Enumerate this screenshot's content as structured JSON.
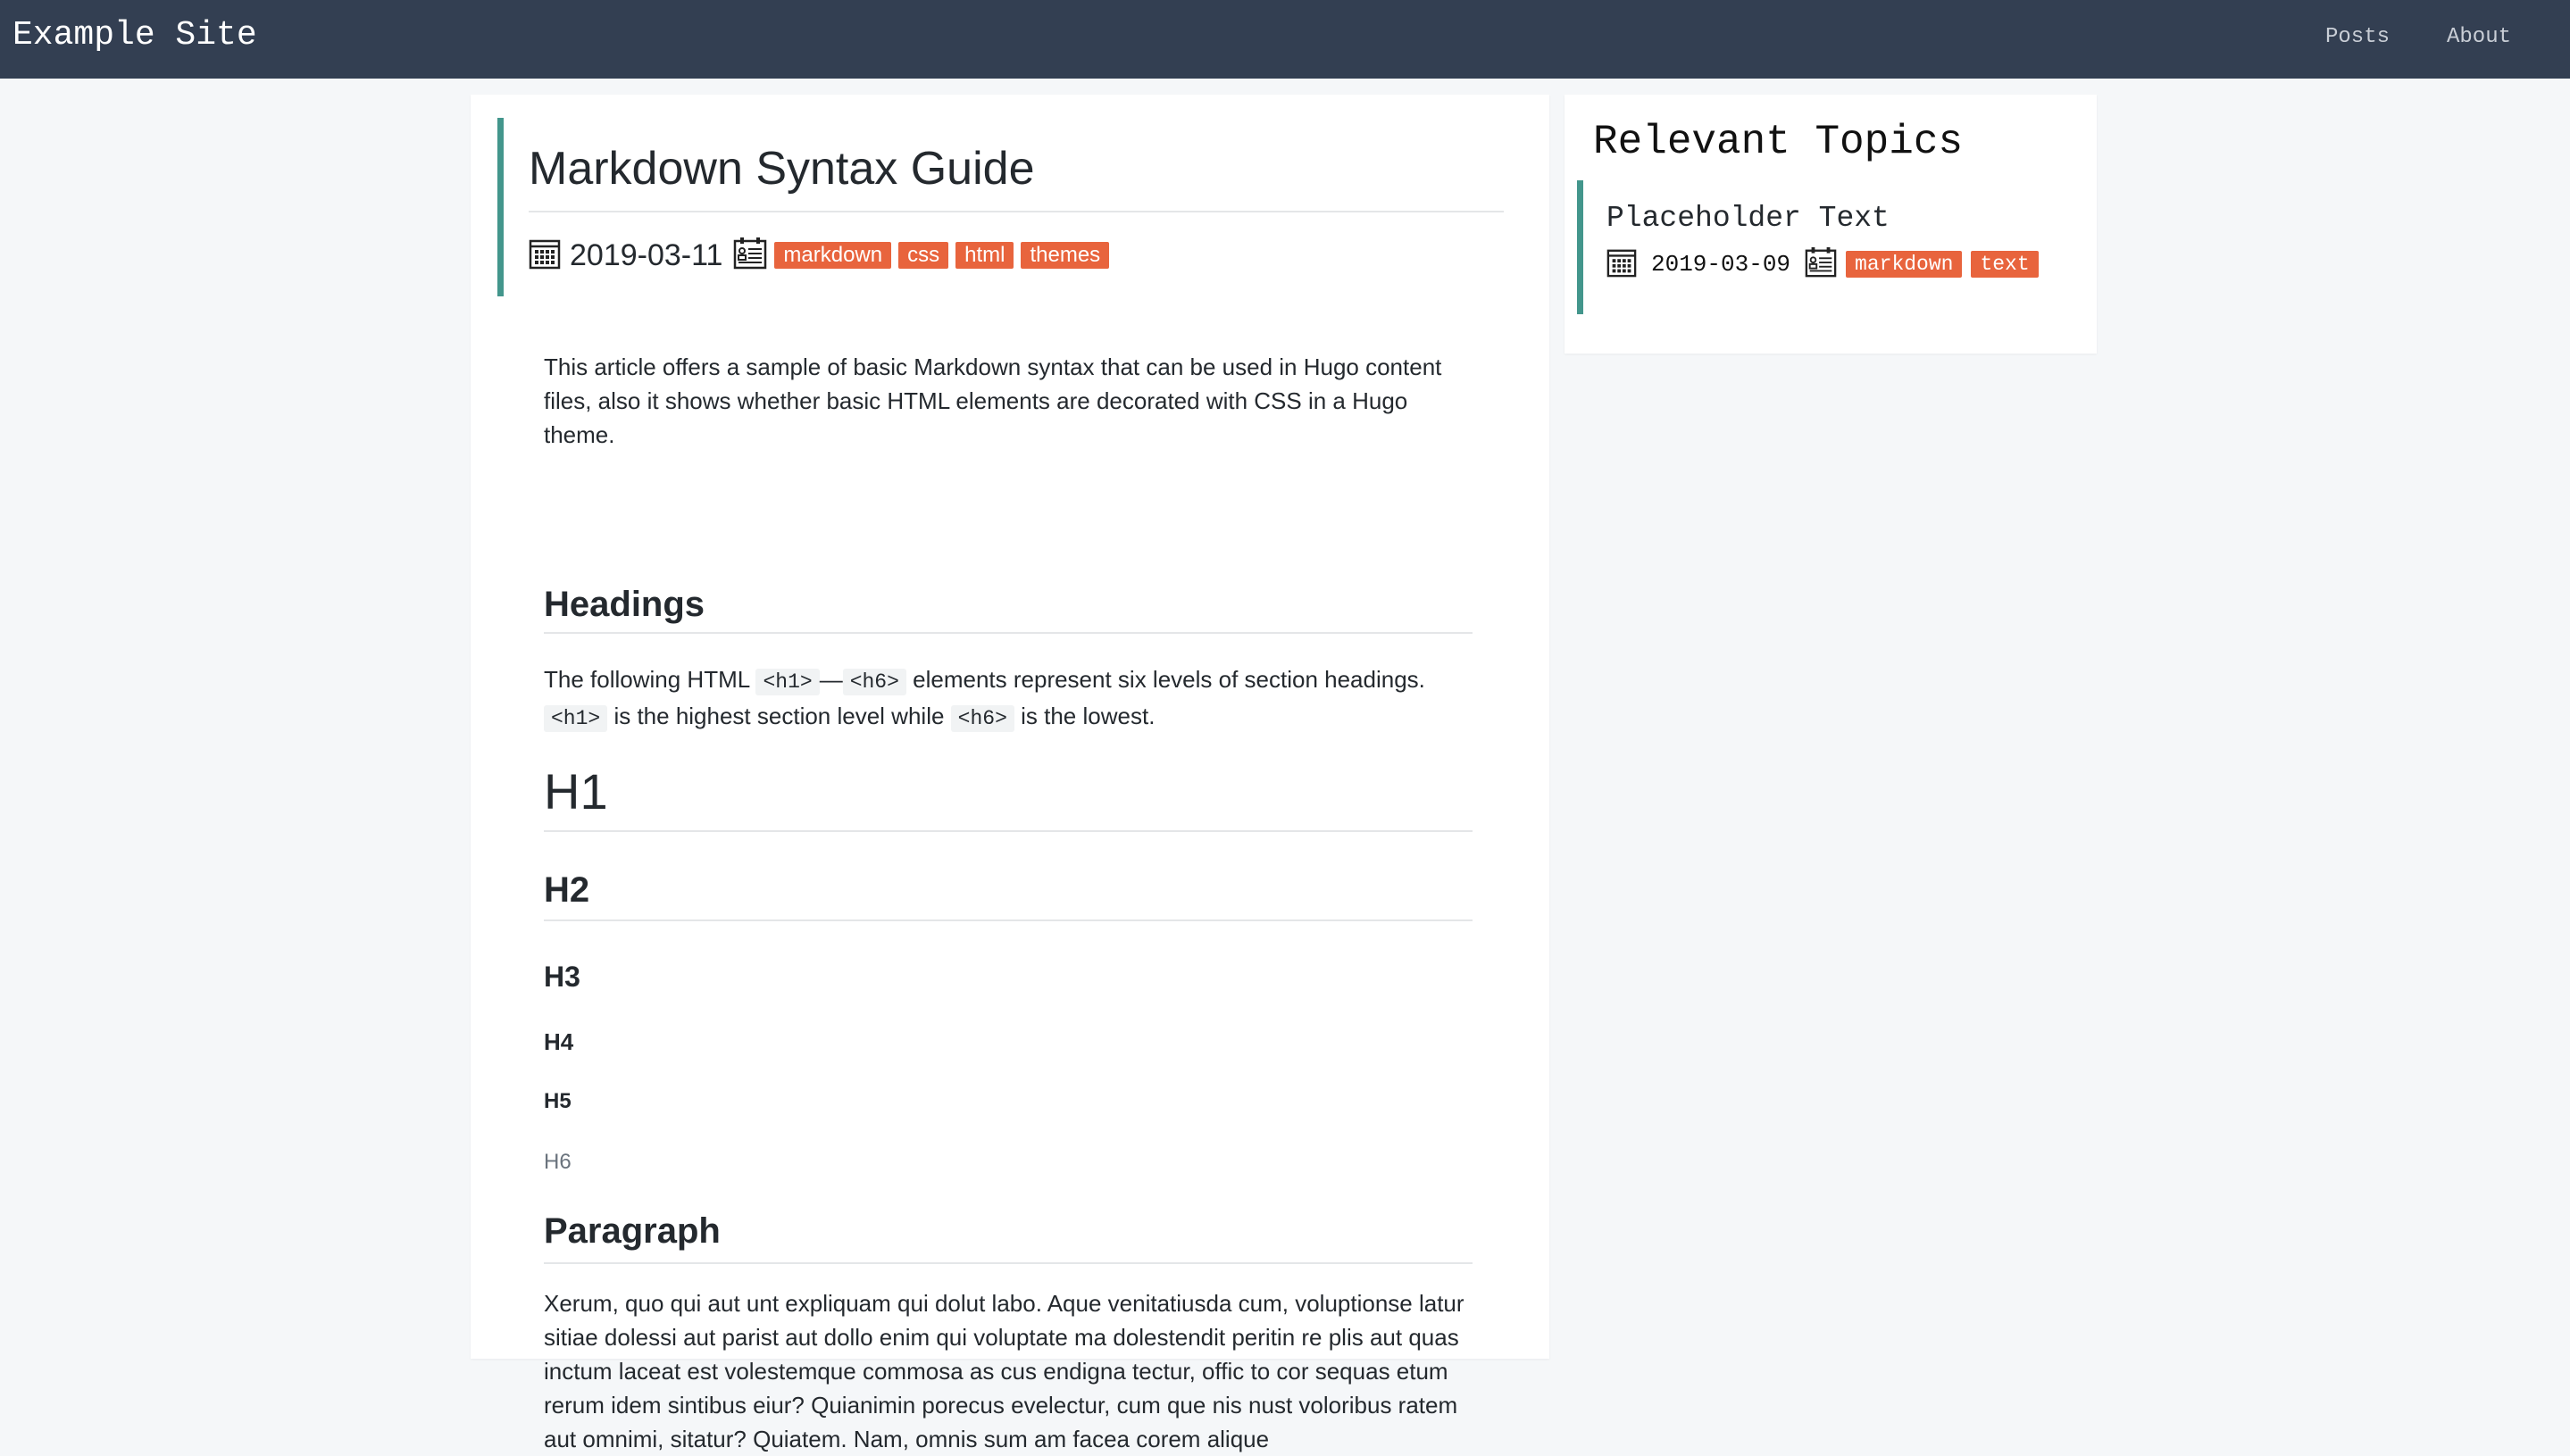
{
  "site": {
    "brand": "Example Site"
  },
  "nav": {
    "items": [
      {
        "label": "Posts"
      },
      {
        "label": "About"
      }
    ]
  },
  "post": {
    "title": "Markdown Syntax Guide",
    "date": "2019-03-11",
    "tags": [
      "markdown",
      "css",
      "html",
      "themes"
    ],
    "intro": "This article offers a sample of basic Markdown syntax that can be used in Hugo content files, also it shows whether basic HTML elements are decorated with CSS in a Hugo theme.",
    "headings_title": "Headings",
    "headings_text": {
      "part1": "The following HTML",
      "code1": "<h1>",
      "dash": "—",
      "code2": "<h6>",
      "part2": "elements represent six levels of section headings.",
      "code3": "<h1>",
      "part3": "is the highest section level while",
      "code4": "<h6>",
      "part4": "is the lowest."
    },
    "levels": [
      "H1",
      "H2",
      "H3",
      "H4",
      "H5",
      "H6"
    ],
    "paragraph_title": "Paragraph",
    "paragraph_text": "Xerum, quo qui aut unt expliquam qui dolut labo. Aque venitatiusda cum, voluptionse latur sitiae dolessi aut parist aut dollo enim qui voluptate ma dolestendit peritin re plis aut quas inctum laceat est volestemque commosa as cus endigna tectur, offic to cor sequas etum rerum idem sintibus eiur? Quianimin porecus evelectur, cum que nis nust voloribus ratem aut omnimi, sitatur? Quiatem. Nam, omnis sum am facea corem alique"
  },
  "sidebar": {
    "title": "Relevant Topics",
    "topics": [
      {
        "title": "Placeholder Text",
        "date": "2019-03-09",
        "tags": [
          "markdown",
          "text"
        ]
      }
    ]
  },
  "colors": {
    "navbar": "#333f52",
    "accent_border": "#43968c",
    "tag_bg": "#e8643d",
    "page_bg": "#f5f7f9"
  },
  "icons": {
    "date": "calendar-icon",
    "tags": "tag-card-icon"
  }
}
